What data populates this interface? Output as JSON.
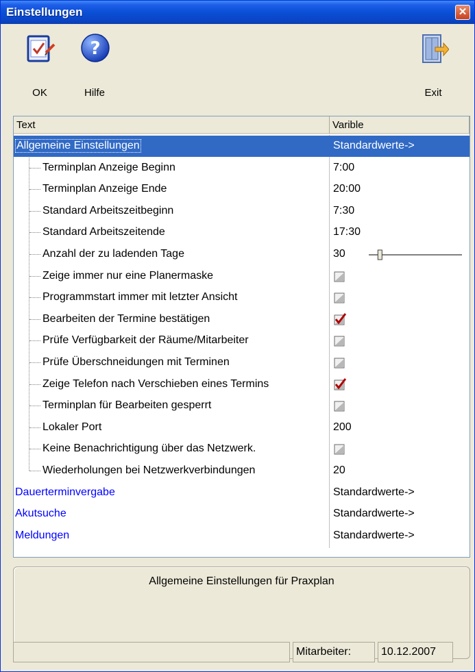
{
  "window": {
    "title": "Einstellungen",
    "close_glyph": "✕"
  },
  "toolbar": {
    "ok_label": "OK",
    "help_label": "Hilfe",
    "exit_label": "Exit",
    "icons": {
      "ok": "clipboard-check-icon",
      "help": "question-icon",
      "exit": "door-exit-icon"
    }
  },
  "tree": {
    "columns": [
      "Text",
      "Varible"
    ],
    "rows": [
      {
        "text": "Allgemeine Einstellungen",
        "value": "Standardwerte->",
        "kind": "group",
        "selected": true
      },
      {
        "text": "Terminplan Anzeige Beginn",
        "value": "7:00",
        "kind": "text"
      },
      {
        "text": "Terminplan Anzeige Ende",
        "value": "20:00",
        "kind": "text"
      },
      {
        "text": "Standard Arbeitszeitbeginn",
        "value": "7:30",
        "kind": "text"
      },
      {
        "text": "Standard Arbeitszeitende",
        "value": "17:30",
        "kind": "text"
      },
      {
        "text": "Anzahl der zu ladenden Tage",
        "value": "30",
        "kind": "slider",
        "slider_fraction": 0.12
      },
      {
        "text": "Zeige immer nur eine Planermaske",
        "kind": "checkbox",
        "checked": false
      },
      {
        "text": "Programmstart immer mit letzter Ansicht",
        "kind": "checkbox",
        "checked": false
      },
      {
        "text": "Bearbeiten der Termine bestätigen",
        "kind": "checkbox",
        "checked": true
      },
      {
        "text": "Prüfe Verfügbarkeit der Räume/Mitarbeiter",
        "kind": "checkbox",
        "checked": false
      },
      {
        "text": "Prüfe Überschneidungen mit Terminen",
        "kind": "checkbox",
        "checked": false
      },
      {
        "text": "Zeige Telefon nach Verschieben eines Termins",
        "kind": "checkbox",
        "checked": true
      },
      {
        "text": "Terminplan für Bearbeiten gesperrt",
        "kind": "checkbox",
        "checked": false
      },
      {
        "text": "Lokaler Port",
        "value": "200",
        "kind": "text"
      },
      {
        "text": "Keine Benachrichtigung über das Netzwerk.",
        "kind": "checkbox",
        "checked": false
      },
      {
        "text": "Wiederholungen bei Netzwerkverbindungen",
        "value": "20",
        "kind": "text"
      },
      {
        "text": "Dauerterminvergabe",
        "value": "Standardwerte->",
        "kind": "group"
      },
      {
        "text": "Akutsuche",
        "value": "Standardwerte->",
        "kind": "group"
      },
      {
        "text": "Meldungen",
        "value": "Standardwerte->",
        "kind": "group"
      }
    ]
  },
  "description": "Allgemeine Einstellungen für Praxplan",
  "statusbar": {
    "left": "",
    "staff_label": "Mitarbeiter:",
    "date": "10.12.2007"
  },
  "colors": {
    "group_link": "#0000ff",
    "selection": "#316ac5",
    "titlebar": "#0a4fd6",
    "check_mark": "#b00000"
  }
}
